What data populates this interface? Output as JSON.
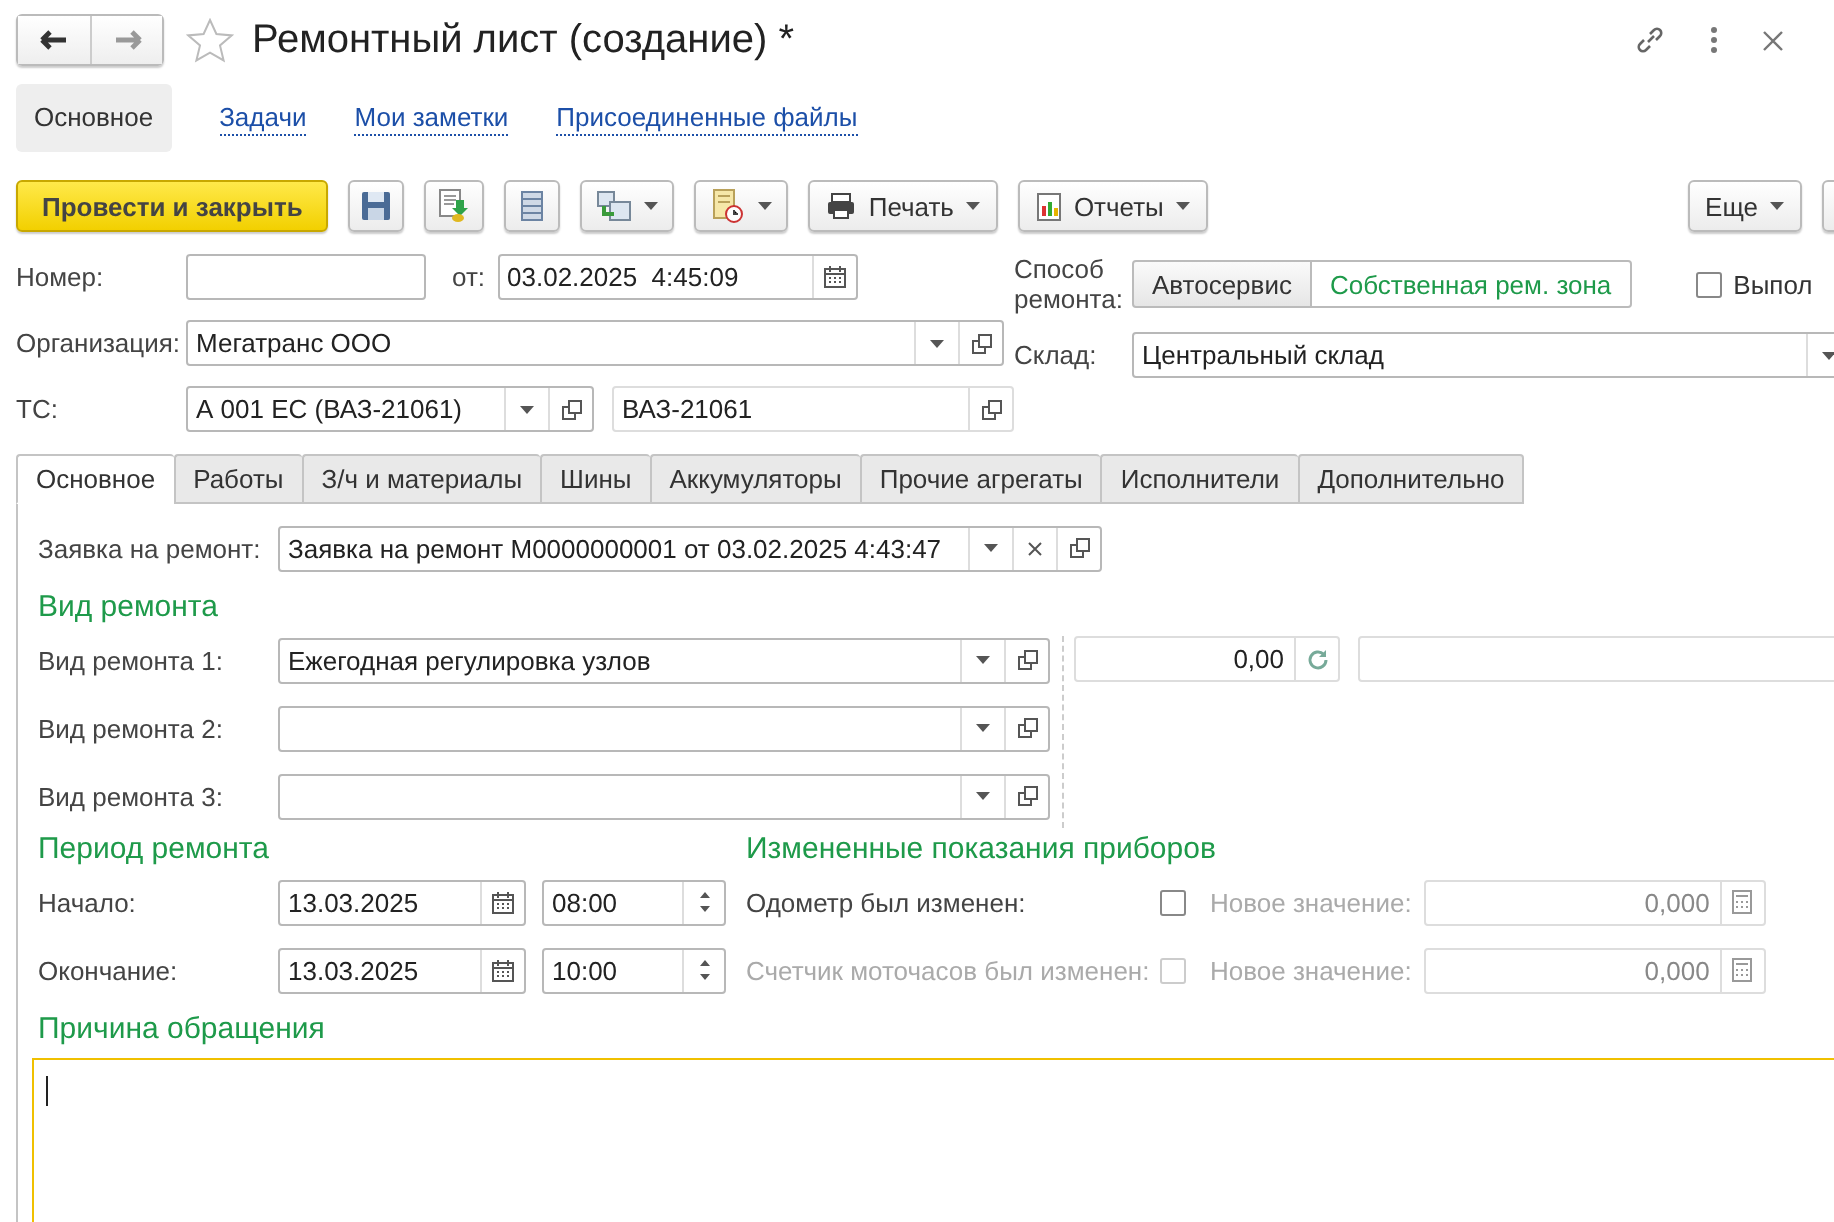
{
  "window": {
    "title": "Ремонтный лист (создание) *"
  },
  "nav_tabs": [
    {
      "label": "Основное",
      "selected": true
    },
    {
      "label": "Задачи",
      "selected": false
    },
    {
      "label": "Мои заметки",
      "selected": false
    },
    {
      "label": "Присоединенные файлы",
      "selected": false
    }
  ],
  "toolbar": {
    "primary": "Провести и закрыть",
    "print": "Печать",
    "reports": "Отчеты",
    "more": "Еще"
  },
  "number": {
    "label": "Номер:"
  },
  "date": {
    "label": "от:",
    "value": "03.02.2025  4:45:09"
  },
  "organization": {
    "label": "Организация:",
    "value": "Мегатранс ООО"
  },
  "vehicle": {
    "label": "ТС:",
    "value": "А 001 ЕС (ВАЗ-21061)",
    "model": "ВАЗ-21061"
  },
  "repair_method": {
    "label": "Способ ремонта:",
    "options": [
      {
        "label": "Автосервис",
        "selected": false
      },
      {
        "label": "Собственная рем. зона",
        "selected": true
      }
    ]
  },
  "done": {
    "label": "Выпол",
    "checked": false
  },
  "warehouse": {
    "label": "Склад:",
    "value": "Центральный склад"
  },
  "tabs": [
    {
      "label": "Основное",
      "selected": true
    },
    {
      "label": "Работы",
      "selected": false
    },
    {
      "label": "З/ч и материалы",
      "selected": false
    },
    {
      "label": "Шины",
      "selected": false
    },
    {
      "label": "Аккумуляторы",
      "selected": false
    },
    {
      "label": "Прочие агрегаты",
      "selected": false
    },
    {
      "label": "Исполнители",
      "selected": false
    },
    {
      "label": "Дополнительно",
      "selected": false
    }
  ],
  "request": {
    "label": "Заявка на ремонт:",
    "value": "Заявка на ремонт М0000000001 от 03.02.2025 4:43:47"
  },
  "repair_types": {
    "title": "Вид ремонта",
    "amount": "0,00",
    "rows": [
      {
        "label": "Вид ремонта 1:",
        "value": "Ежегодная регулировка узлов"
      },
      {
        "label": "Вид ремонта 2:"
      },
      {
        "label": "Вид ремонта 3:"
      }
    ]
  },
  "period": {
    "title": "Период ремонта",
    "rows": [
      {
        "label": "Начало:",
        "date": "13.03.2025",
        "time": "08:00"
      },
      {
        "label": "Окончание:",
        "date": "13.03.2025",
        "time": "10:00"
      }
    ]
  },
  "meters": {
    "title": "Измененные показания приборов",
    "rows": [
      {
        "label": "Одометр был изменен:",
        "disabled": false,
        "checked": false,
        "value_label": "Новое значение:",
        "value": "0,000"
      },
      {
        "label": "Счетчик моточасов был изменен:",
        "disabled": true,
        "checked": false,
        "value_label": "Новое значение:",
        "value": "0,000"
      }
    ]
  },
  "reason": {
    "title": "Причина обращения"
  }
}
